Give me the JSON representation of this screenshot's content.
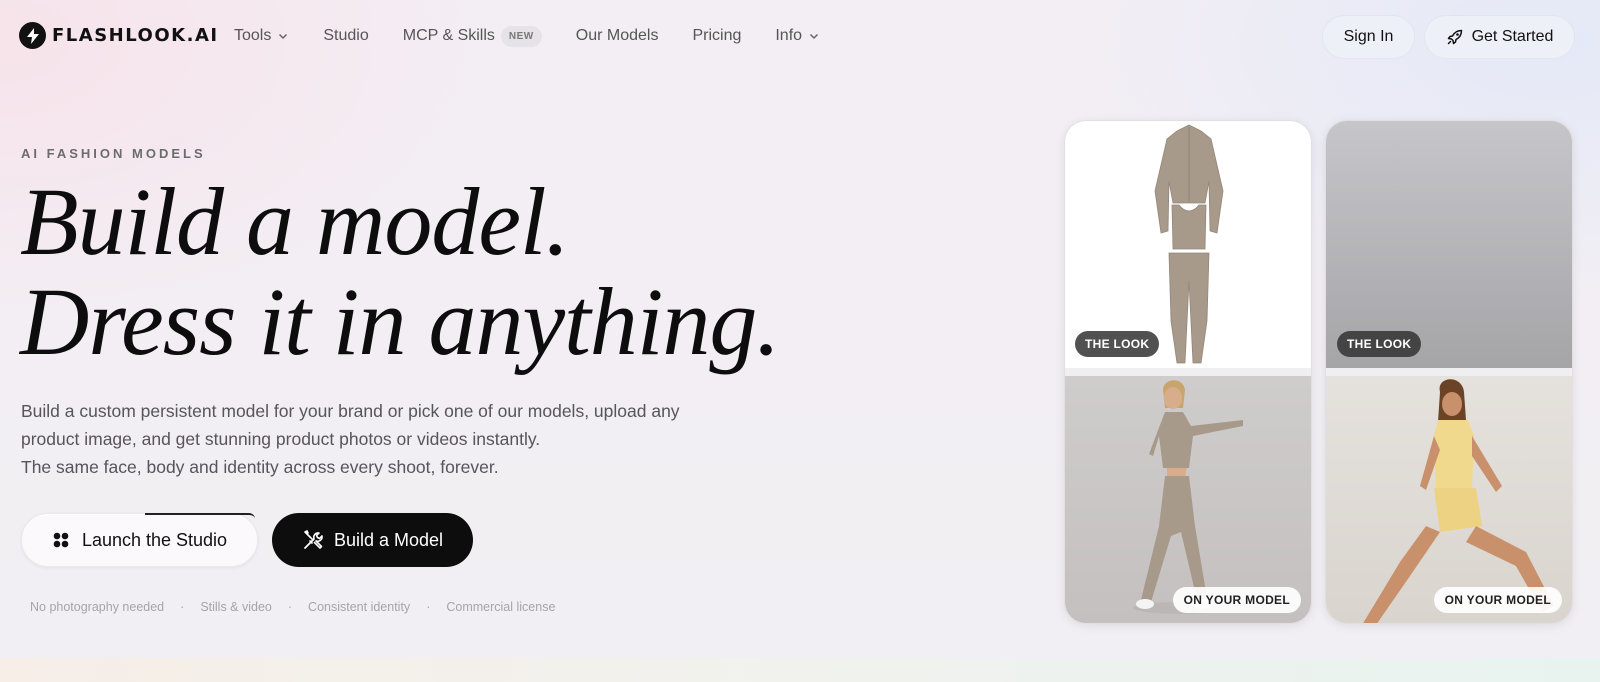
{
  "brand": {
    "name": "FLASHLOOK.AI"
  },
  "nav": {
    "links": [
      {
        "label": "Tools",
        "dropdown": true
      },
      {
        "label": "Studio",
        "dropdown": false
      },
      {
        "label": "MCP & Skills",
        "badge": "NEW"
      },
      {
        "label": "Our Models",
        "dropdown": false
      },
      {
        "label": "Pricing",
        "dropdown": false
      },
      {
        "label": "Info",
        "dropdown": true
      }
    ],
    "sign_in": "Sign In",
    "get_started": "Get Started"
  },
  "hero": {
    "eyebrow": "AI FASHION MODELS",
    "headline_line1": "Build a model.",
    "headline_line2": "Dress it in anything.",
    "sub_line1": "Build a custom persistent model for your brand or pick one of our models, upload any",
    "sub_line2": "product image, and get stunning product photos or videos instantly.",
    "sub_line3": "The same face, body and identity across every shoot, forever.",
    "launch_label": "Launch the Studio",
    "build_label": "Build a Model",
    "features": [
      "No photography needed",
      "Stills & video",
      "Consistent identity",
      "Commercial license"
    ],
    "feature_separator": "·"
  },
  "cards": [
    {
      "look_tag": "THE LOOK",
      "model_tag": "ON YOUR MODEL",
      "outfit_color": "#a89a8a"
    },
    {
      "look_tag": "THE LOOK",
      "model_tag": "ON YOUR MODEL",
      "outfit_color": "#f0d98c"
    }
  ],
  "icons": {
    "logo": "lightning-bolt-icon",
    "chevron": "chevron-down-icon",
    "rocket": "rocket-icon",
    "studio": "four-dots-icon",
    "build": "tools-icon"
  }
}
